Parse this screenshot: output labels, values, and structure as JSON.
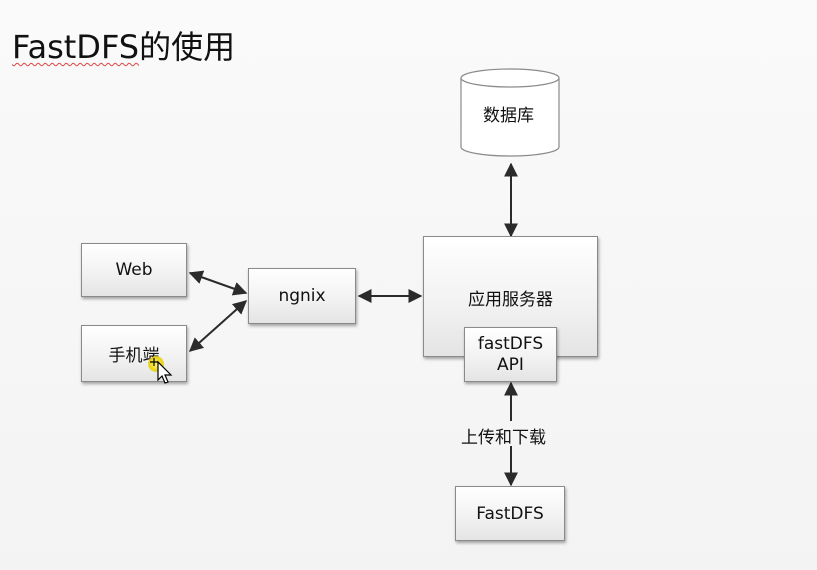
{
  "slide": {
    "title_prefix": "FastDFS",
    "title_suffix": "的使用"
  },
  "nodes": {
    "database": "数据库",
    "web": "Web",
    "mobile": "手机端",
    "ngnix": "ngnix",
    "app_server": "应用服务器",
    "api_line1": "fastDFS",
    "api_line2": "API",
    "fastdfs": "FastDFS"
  },
  "edges": {
    "upload_download": "上传和下载"
  },
  "colors": {
    "arrow": "#2b2b2b",
    "box_border": "#8a8a8a",
    "title_underline": "#d44444"
  }
}
